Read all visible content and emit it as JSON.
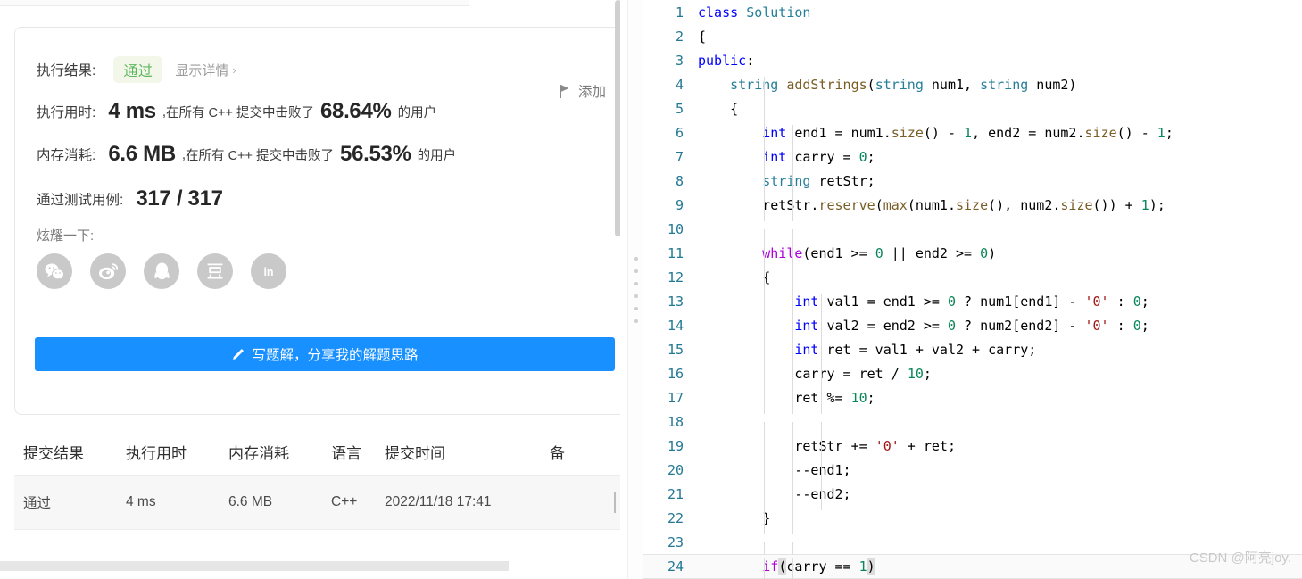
{
  "left_panel": {
    "result": {
      "label": "执行结果:",
      "status": "通过",
      "detail_link": "显示详情",
      "detail_chevron": "›"
    },
    "add_note": {
      "label": "添加",
      "icon": "flag-icon"
    },
    "runtime": {
      "label": "执行用时:",
      "value": "4 ms",
      "separator": ",",
      "prefix": "在所有 C++ 提交中击败了",
      "percent": "68.64%",
      "suffix": "的用户"
    },
    "memory": {
      "label": "内存消耗:",
      "value": "6.6 MB",
      "separator": ",",
      "prefix": "在所有 C++ 提交中击败了",
      "percent": "56.53%",
      "suffix": "的用户"
    },
    "testcases": {
      "label": "通过测试用例:",
      "value": "317 / 317"
    },
    "share": {
      "label": "炫耀一下:",
      "icons": [
        {
          "name": "wechat-icon"
        },
        {
          "name": "weibo-icon"
        },
        {
          "name": "qq-icon"
        },
        {
          "name": "douban-icon"
        },
        {
          "name": "linkedin-icon"
        }
      ]
    },
    "write_solution_button": {
      "label": "写题解，分享我的解题思路",
      "icon": "pencil-icon",
      "color": "#1890ff"
    },
    "submissions": {
      "headers": [
        "提交结果",
        "执行用时",
        "内存消耗",
        "语言",
        "提交时间",
        "备"
      ],
      "rows": [
        {
          "status": "通过",
          "runtime": "4 ms",
          "memory": "6.6 MB",
          "language": "C++",
          "time": "2022/11/18 17:41"
        }
      ]
    }
  },
  "editor": {
    "language": "cpp",
    "lines": [
      {
        "n": "1",
        "guides": 0,
        "tokens": [
          {
            "t": "class ",
            "c": "kw"
          },
          {
            "t": "Solution",
            "c": "typ"
          }
        ]
      },
      {
        "n": "2",
        "guides": 0,
        "tokens": [
          {
            "t": "{",
            "c": "plain"
          }
        ]
      },
      {
        "n": "3",
        "guides": 0,
        "tokens": [
          {
            "t": "public",
            "c": "kw"
          },
          {
            "t": ":",
            "c": "plain"
          }
        ]
      },
      {
        "n": "4",
        "guides": 1,
        "tokens": [
          {
            "t": "    ",
            "c": "plain"
          },
          {
            "t": "string",
            "c": "typ"
          },
          {
            "t": " ",
            "c": "plain"
          },
          {
            "t": "addStrings",
            "c": "fn"
          },
          {
            "t": "(",
            "c": "plain"
          },
          {
            "t": "string",
            "c": "typ"
          },
          {
            "t": " num1, ",
            "c": "plain"
          },
          {
            "t": "string",
            "c": "typ"
          },
          {
            "t": " num2)",
            "c": "plain"
          }
        ]
      },
      {
        "n": "5",
        "guides": 1,
        "tokens": [
          {
            "t": "    {",
            "c": "plain"
          }
        ]
      },
      {
        "n": "6",
        "guides": 2,
        "tokens": [
          {
            "t": "        ",
            "c": "plain"
          },
          {
            "t": "int",
            "c": "kw"
          },
          {
            "t": " end1 = num1.",
            "c": "plain"
          },
          {
            "t": "size",
            "c": "fn"
          },
          {
            "t": "() - ",
            "c": "plain"
          },
          {
            "t": "1",
            "c": "num"
          },
          {
            "t": ", end2 = num2.",
            "c": "plain"
          },
          {
            "t": "size",
            "c": "fn"
          },
          {
            "t": "() - ",
            "c": "plain"
          },
          {
            "t": "1",
            "c": "num"
          },
          {
            "t": ";",
            "c": "plain"
          }
        ]
      },
      {
        "n": "7",
        "guides": 2,
        "tokens": [
          {
            "t": "        ",
            "c": "plain"
          },
          {
            "t": "int",
            "c": "kw"
          },
          {
            "t": " carry = ",
            "c": "plain"
          },
          {
            "t": "0",
            "c": "num"
          },
          {
            "t": ";",
            "c": "plain"
          }
        ]
      },
      {
        "n": "8",
        "guides": 2,
        "tokens": [
          {
            "t": "        ",
            "c": "plain"
          },
          {
            "t": "string",
            "c": "typ"
          },
          {
            "t": " retStr;",
            "c": "plain"
          }
        ]
      },
      {
        "n": "9",
        "guides": 2,
        "tokens": [
          {
            "t": "        retStr.",
            "c": "plain"
          },
          {
            "t": "reserve",
            "c": "fn"
          },
          {
            "t": "(",
            "c": "plain"
          },
          {
            "t": "max",
            "c": "fn"
          },
          {
            "t": "(num1.",
            "c": "plain"
          },
          {
            "t": "size",
            "c": "fn"
          },
          {
            "t": "(), num2.",
            "c": "plain"
          },
          {
            "t": "size",
            "c": "fn"
          },
          {
            "t": "()) + ",
            "c": "plain"
          },
          {
            "t": "1",
            "c": "num"
          },
          {
            "t": ");",
            "c": "plain"
          }
        ]
      },
      {
        "n": "10",
        "guides": 2,
        "tokens": []
      },
      {
        "n": "11",
        "guides": 2,
        "tokens": [
          {
            "t": "        ",
            "c": "plain"
          },
          {
            "t": "while",
            "c": "kw2"
          },
          {
            "t": "(end1 >= ",
            "c": "plain"
          },
          {
            "t": "0",
            "c": "num"
          },
          {
            "t": " || end2 >= ",
            "c": "plain"
          },
          {
            "t": "0",
            "c": "num"
          },
          {
            "t": ")",
            "c": "plain"
          }
        ]
      },
      {
        "n": "12",
        "guides": 2,
        "tokens": [
          {
            "t": "        {",
            "c": "plain"
          }
        ]
      },
      {
        "n": "13",
        "guides": 3,
        "tokens": [
          {
            "t": "            ",
            "c": "plain"
          },
          {
            "t": "int",
            "c": "kw"
          },
          {
            "t": " val1 = end1 >= ",
            "c": "plain"
          },
          {
            "t": "0",
            "c": "num"
          },
          {
            "t": " ? num1[end1] - ",
            "c": "plain"
          },
          {
            "t": "'0'",
            "c": "chr"
          },
          {
            "t": " : ",
            "c": "plain"
          },
          {
            "t": "0",
            "c": "num"
          },
          {
            "t": ";",
            "c": "plain"
          }
        ]
      },
      {
        "n": "14",
        "guides": 3,
        "tokens": [
          {
            "t": "            ",
            "c": "plain"
          },
          {
            "t": "int",
            "c": "kw"
          },
          {
            "t": " val2 = end2 >= ",
            "c": "plain"
          },
          {
            "t": "0",
            "c": "num"
          },
          {
            "t": " ? num2[end2] - ",
            "c": "plain"
          },
          {
            "t": "'0'",
            "c": "chr"
          },
          {
            "t": " : ",
            "c": "plain"
          },
          {
            "t": "0",
            "c": "num"
          },
          {
            "t": ";",
            "c": "plain"
          }
        ]
      },
      {
        "n": "15",
        "guides": 3,
        "tokens": [
          {
            "t": "            ",
            "c": "plain"
          },
          {
            "t": "int",
            "c": "kw"
          },
          {
            "t": " ret = val1 + val2 + carry;",
            "c": "plain"
          }
        ]
      },
      {
        "n": "16",
        "guides": 3,
        "tokens": [
          {
            "t": "            carry = ret / ",
            "c": "plain"
          },
          {
            "t": "10",
            "c": "num"
          },
          {
            "t": ";",
            "c": "plain"
          }
        ]
      },
      {
        "n": "17",
        "guides": 3,
        "tokens": [
          {
            "t": "            ret %= ",
            "c": "plain"
          },
          {
            "t": "10",
            "c": "num"
          },
          {
            "t": ";",
            "c": "plain"
          }
        ]
      },
      {
        "n": "18",
        "guides": 3,
        "tokens": []
      },
      {
        "n": "19",
        "guides": 3,
        "tokens": [
          {
            "t": "            retStr += ",
            "c": "plain"
          },
          {
            "t": "'0'",
            "c": "chr"
          },
          {
            "t": " + ret;",
            "c": "plain"
          }
        ]
      },
      {
        "n": "20",
        "guides": 3,
        "tokens": [
          {
            "t": "            --end1;",
            "c": "plain"
          }
        ]
      },
      {
        "n": "21",
        "guides": 3,
        "tokens": [
          {
            "t": "            --end2;",
            "c": "plain"
          }
        ]
      },
      {
        "n": "22",
        "guides": 2,
        "tokens": [
          {
            "t": "        }",
            "c": "plain"
          }
        ]
      },
      {
        "n": "23",
        "guides": 2,
        "tokens": []
      },
      {
        "n": "24",
        "guides": 2,
        "active": true,
        "tokens": [
          {
            "t": "        ",
            "c": "plain"
          },
          {
            "t": "if",
            "c": "kw2"
          },
          {
            "t": "(",
            "c": "brkt"
          },
          {
            "t": "carry == ",
            "c": "plain"
          },
          {
            "t": "1",
            "c": "num"
          },
          {
            "t": ")",
            "c": "brkt"
          }
        ]
      }
    ]
  },
  "watermark": "CSDN @阿亮joy."
}
